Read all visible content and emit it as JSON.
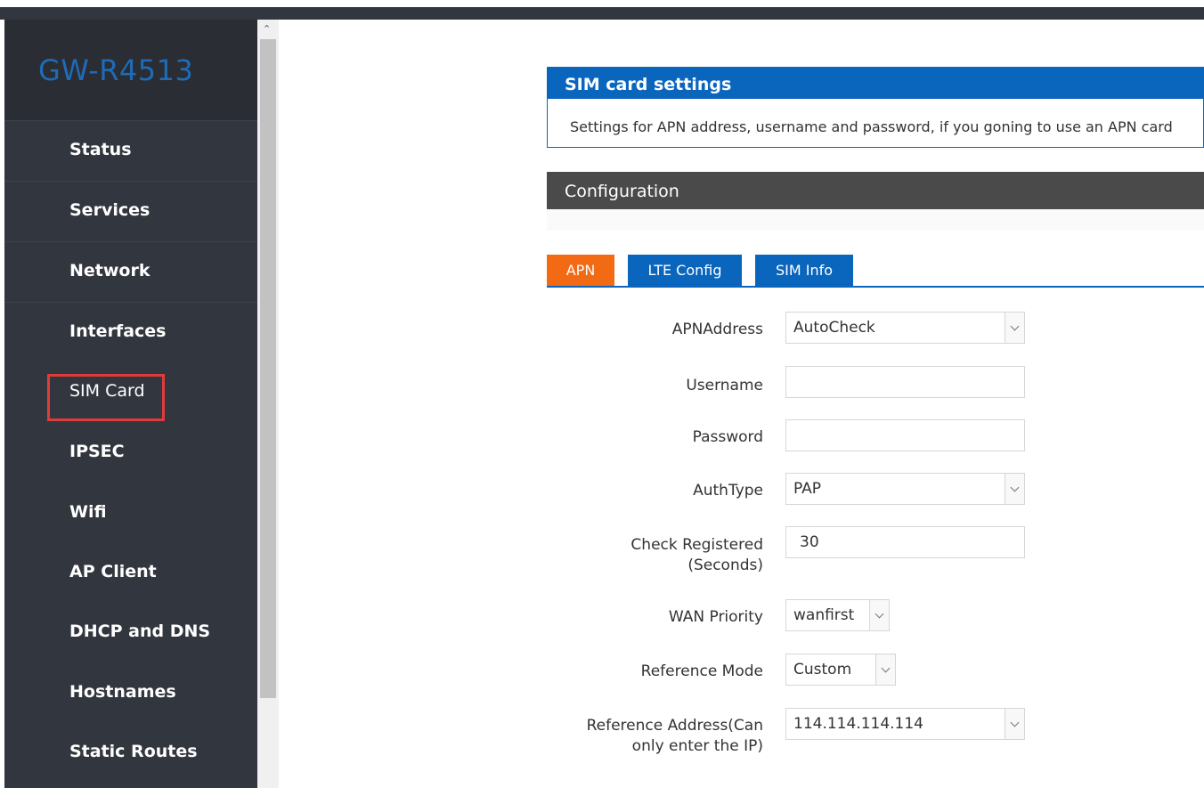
{
  "app": {
    "title": "GW-R4513"
  },
  "sidebar": {
    "items": [
      {
        "label": "Status"
      },
      {
        "label": "Services"
      },
      {
        "label": "Network"
      },
      {
        "label": "Interfaces"
      },
      {
        "label": "SIM Card"
      },
      {
        "label": "IPSEC"
      },
      {
        "label": "Wifi"
      },
      {
        "label": "AP Client"
      },
      {
        "label": "DHCP and DNS"
      },
      {
        "label": "Hostnames"
      },
      {
        "label": "Static Routes"
      }
    ],
    "selected": "SIM Card"
  },
  "header": {
    "title": "SIM card settings",
    "description": "Settings for APN address, username and password, if you goning to use an APN card"
  },
  "section": {
    "title": "Configuration"
  },
  "tabs": [
    {
      "label": "APN",
      "active": true
    },
    {
      "label": "LTE Config",
      "active": false
    },
    {
      "label": "SIM Info",
      "active": false
    }
  ],
  "form": {
    "apn_address": {
      "label": "APNAddress",
      "value": "AutoCheck"
    },
    "username": {
      "label": "Username",
      "value": ""
    },
    "password": {
      "label": "Password",
      "value": ""
    },
    "auth_type": {
      "label": "AuthType",
      "value": "PAP"
    },
    "check_registered": {
      "label_line1": "Check Registered",
      "label_line2": "(Seconds)",
      "value": "30"
    },
    "wan_priority": {
      "label": "WAN Priority",
      "value": "wanfirst"
    },
    "reference_mode": {
      "label": "Reference Mode",
      "value": "Custom"
    },
    "reference_address": {
      "label_line1": "Reference Address(Can",
      "label_line2": "only enter the IP)",
      "value": "114.114.114.114"
    }
  },
  "colors": {
    "sidebar_bg": "#32363e",
    "brand_text": "#1e6bb8",
    "header_blue": "#0a65bd",
    "tab_active": "#f26a14",
    "config_bar": "#4a4a4a",
    "highlight": "#e03b3b"
  }
}
